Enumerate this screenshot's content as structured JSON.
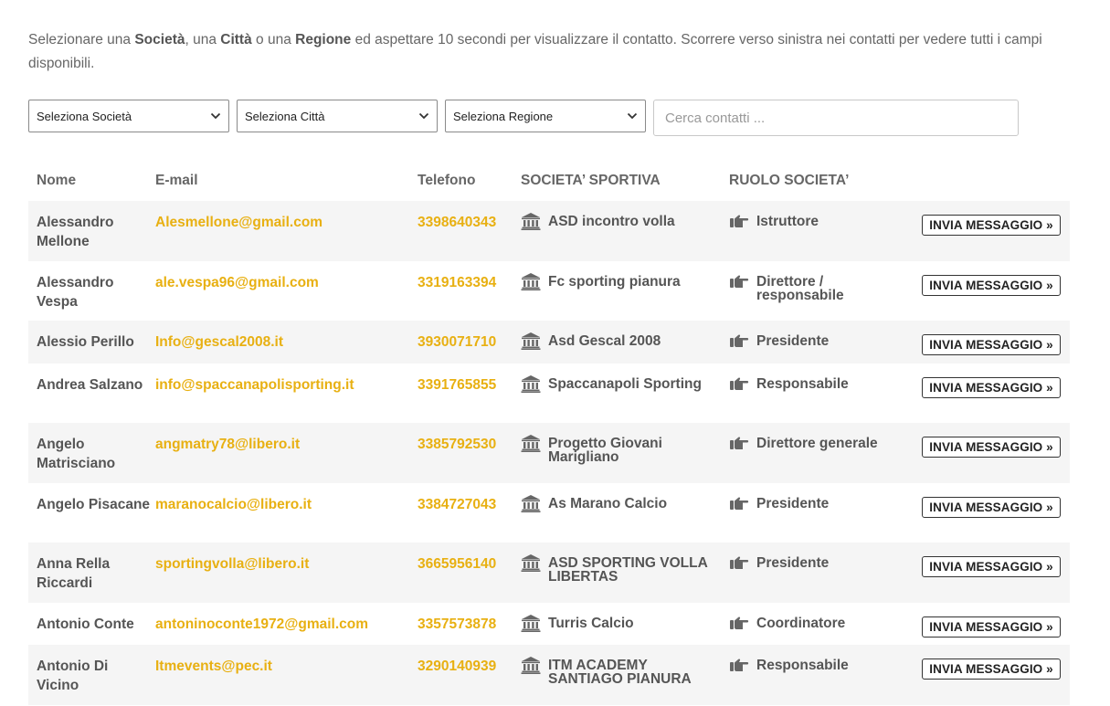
{
  "intro": {
    "t1": "Selezionare una ",
    "b1": "Società",
    "t2": ", una ",
    "b2": "Città",
    "t3": " o una ",
    "b3": "Regione",
    "t4": " ed aspettare 10 secondi per visualizzare il contatto. Scorrere verso sinistra nei contatti per vedere tutti i campi disponibili."
  },
  "filters": {
    "societa": "Seleziona Società",
    "citta": "Seleziona Città",
    "regione": "Seleziona Regione",
    "search_placeholder": "Cerca contatti ..."
  },
  "headers": {
    "nome": "Nome",
    "email": "E-mail",
    "telefono": "Telefono",
    "societa": "SOCIETA’ SPORTIVA",
    "ruolo": "RUOLO SOCIETA’"
  },
  "button_label": "INVIA MESSAGGIO »",
  "icons": {
    "societa": "bank-icon",
    "ruolo": "hand-pointing-right-icon",
    "dropdown": "chevron-down-icon"
  },
  "colors": {
    "link": "#e8b012",
    "text": "#555555",
    "row_alt": "#f5f5f5"
  },
  "rows": [
    {
      "name": "Alessandro Mellone",
      "email": "Alesmellone@gmail.com",
      "phone": "3398640343",
      "societa": "ASD incontro volla",
      "ruolo": "Istruttore"
    },
    {
      "name": "Alessandro Vespa",
      "email": "ale.vespa96@gmail.com",
      "phone": "3319163394",
      "societa": "Fc sporting pianura",
      "ruolo": "Direttore / responsabile"
    },
    {
      "name": "Alessio Perillo",
      "email": "Info@gescal2008.it",
      "phone": "3930071710",
      "societa": "Asd Gescal 2008",
      "ruolo": "Presidente"
    },
    {
      "name": "Andrea Salzano",
      "email": "info@spaccanapolisporting.it",
      "phone": "3391765855",
      "societa": "Spaccanapoli Sporting",
      "ruolo": "Responsabile"
    },
    {
      "name": "Angelo Matrisciano",
      "email": "angmatry78@libero.it",
      "phone": "3385792530",
      "societa": "Progetto Giovani Marigliano",
      "ruolo": "Direttore generale"
    },
    {
      "name": "Angelo Pisacane",
      "email": "maranocalcio@libero.it",
      "phone": "3384727043",
      "societa": "As Marano Calcio",
      "ruolo": "Presidente"
    },
    {
      "name": "Anna Rella Riccardi",
      "email": "sportingvolla@libero.it",
      "phone": "3665956140",
      "societa": "ASD SPORTING VOLLA LIBERTAS",
      "ruolo": "Presidente"
    },
    {
      "name": "Antonio Conte",
      "email": "antoninoconte1972@gmail.com",
      "phone": "3357573878",
      "societa": "Turris Calcio",
      "ruolo": "Coordinatore"
    },
    {
      "name": "Antonio Di Vicino",
      "email": "Itmevents@pec.it",
      "phone": "3290140939",
      "societa": "ITM ACADEMY SANTIAGO PIANURA",
      "ruolo": "Responsabile"
    }
  ]
}
